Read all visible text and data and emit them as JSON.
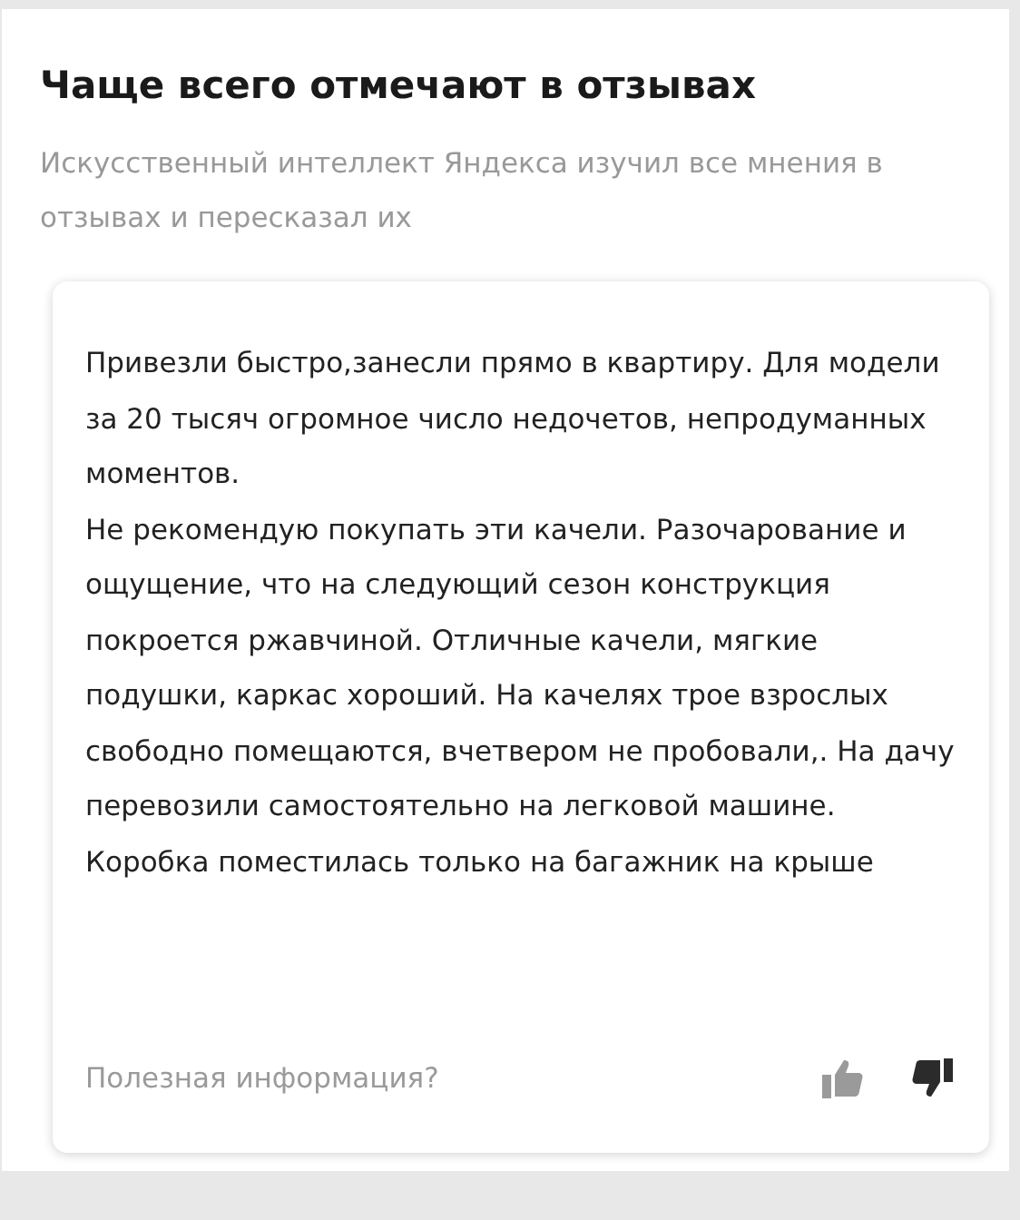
{
  "section": {
    "title": "Чаще всего отмечают в отзывах",
    "subtitle": "Искусственный интеллект Яндекса изучил все мнения в отзывах и пересказал их"
  },
  "review": {
    "text": "Привезли быстро,занесли прямо в квартиру. Для модели за 20 тысяч огромное число недочетов, непродуманных моментов.\nНе рекомендую покупать эти качели. Разочарование и ощущение, что на следующий сезон конструкция покроется ржавчиной. Отличные качели, мягкие подушки, каркас хороший. На качелях трое взрослых свободно помещаются, вчетвером не пробовали,. На дачу перевозили самостоятельно на легковой машине. Коробка поместилась только на багажник на крыше",
    "feedback_prompt": "Полезная информация?"
  }
}
